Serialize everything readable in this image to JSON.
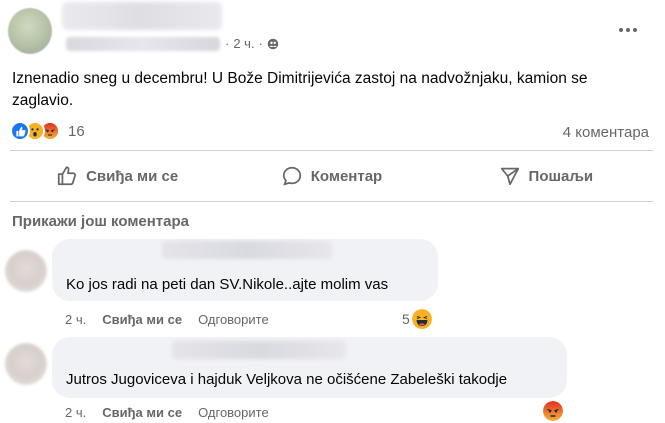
{
  "post": {
    "time": "2 ч.",
    "text": "Iznenadio sneg u decembru! U Bože Dimitrijevića zastoj na nadvožnjaku, kamion se zaglavio.",
    "reactions_count": "16",
    "comments_count": "4 коментара",
    "reaction_icons": [
      "like-icon",
      "wow-icon",
      "angry-icon"
    ]
  },
  "actions": {
    "like": "Свиђа ми се",
    "comment": "Коментар",
    "share": "Пошаљи"
  },
  "more_comments": "Прикажи још коментара",
  "comments": [
    {
      "text": "Ko jos radi na peti dan SV.Nikole..ajte molim vas",
      "time": "2 ч.",
      "like": "Свиђа ми се",
      "reply": "Одговорите",
      "reaction_count": "5",
      "reaction_icon": "haha-icon"
    },
    {
      "text": "Jutros Jugoviceva i hajduk Veljkova ne očišćene Zabeleški takodje",
      "time": "2 ч.",
      "like": "Свиђа ми се",
      "reply": "Одговорите",
      "reaction_icon": "angry-icon"
    }
  ],
  "colors": {
    "secondary_text": "#65676b",
    "bubble": "#f0f2f5",
    "like_blue": "#1877f2"
  }
}
